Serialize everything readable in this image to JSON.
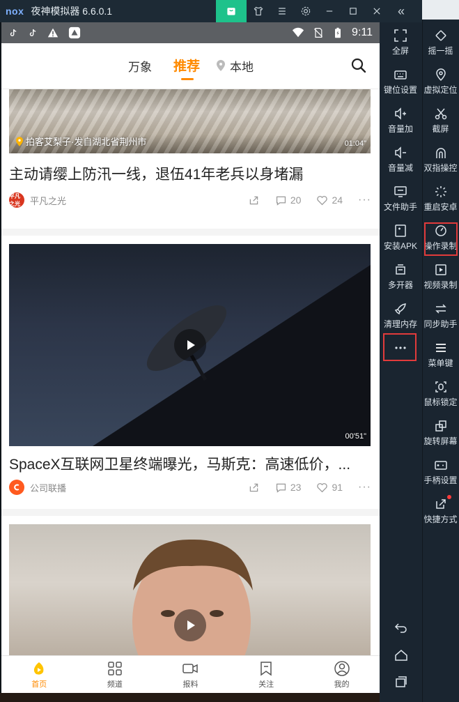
{
  "titlebar": {
    "logo": "nox",
    "title": "夜神模拟器 6.6.0.1",
    "icons": [
      "bag-icon",
      "shirt-icon",
      "menu-icon",
      "gear-icon",
      "minimize-icon",
      "maximize-icon",
      "close-icon"
    ],
    "collapse": "«"
  },
  "statusbar": {
    "time": "9:11"
  },
  "topnav": {
    "tabs": [
      "万象",
      "推荐",
      "本地"
    ],
    "active_tab": "推荐"
  },
  "feed": [
    {
      "location": "拍客艾梨子·发自湖北省荆州市",
      "duration": "01:04\"",
      "title": "主动请缨上防汛一线，退伍41年老兵以身堵漏",
      "author": "平凡之光",
      "avatar_text": "平凡之光",
      "comments": "20",
      "likes": "24"
    },
    {
      "duration": "00'51\"",
      "title": "SpaceX互联网卫星终端曝光，马斯克：高速低价，...",
      "author": "公司联播",
      "comments": "23",
      "likes": "91"
    },
    {}
  ],
  "bottomnav": [
    "首页",
    "频道",
    "报料",
    "关注",
    "我的"
  ],
  "toolbar_left": [
    "全屏",
    "键位设置",
    "音量加",
    "音量减",
    "文件助手",
    "安装APK",
    "多开器",
    "清理内存",
    "..."
  ],
  "toolbar_right": [
    "摇一摇",
    "虚拟定位",
    "截屏",
    "双指操控",
    "重启安卓",
    "操作录制",
    "视频录制",
    "同步助手",
    "菜单键",
    "鼠标锁定",
    "旋转屏幕",
    "手柄设置",
    "快捷方式"
  ],
  "colors": {
    "accent": "#ff8a00",
    "toolbar_bg": "#1a2530",
    "highlight": "#e23b3b",
    "titlebar_active": "#1ec28b"
  }
}
